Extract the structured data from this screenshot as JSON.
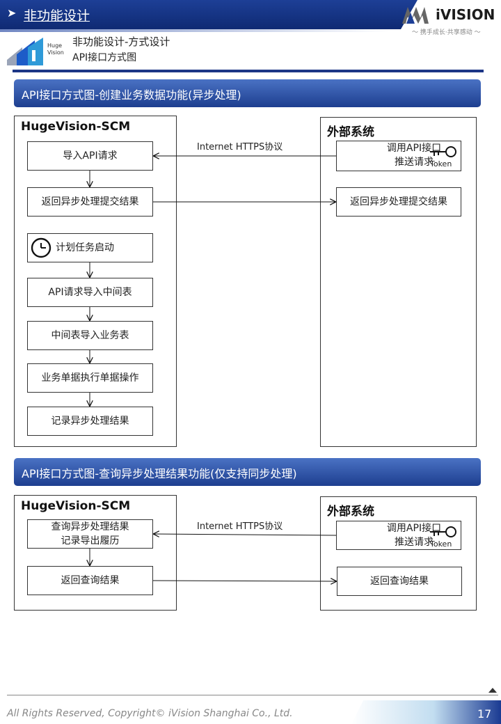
{
  "header": {
    "title": "非功能设计",
    "arrow": "➤",
    "logo_text": "iVISION",
    "logo_slogan": "～ 携手成长·共享感动 ～",
    "huge_logo_line1": "Huge",
    "huge_logo_line2": "Vision",
    "subtitle_line1": "非功能设计-方式设计",
    "subtitle_line2": "API接口方式图"
  },
  "section1": {
    "title": "API接口方式图-创建业务数据功能(异步处理)",
    "left_frame_title": "HugeVision-SCM",
    "right_frame_title": "外部系统",
    "protocol_label": "Internet HTTPS协议",
    "left_steps": [
      "导入API请求",
      "返回异步处理提交结果",
      "计划任务启动",
      "API请求导入中间表",
      "中间表导入业务表",
      "业务单据执行单据操作",
      "记录异步处理结果"
    ],
    "right_call_line1": "调用API接口",
    "right_call_line2": "推送请求",
    "token_label": "Token",
    "right_result": "返回异步处理提交结果"
  },
  "section2": {
    "title": "API接口方式图-查询异步处理结果功能(仅支持同步处理)",
    "left_frame_title": "HugeVision-SCM",
    "right_frame_title": "外部系统",
    "protocol_label": "Internet HTTPS协议",
    "left_step1_line1": "查询异步处理结果",
    "left_step1_line2": "记录导出履历",
    "left_step2": "返回查询结果",
    "right_call_line1": "调用API接口",
    "right_call_line2": "推送请求",
    "token_label": "Token",
    "right_result": "返回查询结果"
  },
  "footer": {
    "copyright": "All Rights Reserved, Copyright© iVision Shanghai Co., Ltd.",
    "page_number": "17"
  },
  "colors": {
    "brand_blue": "#1c3686",
    "section_bar_top": "#4a72c4",
    "section_bar_bottom": "#1d3e8f"
  }
}
